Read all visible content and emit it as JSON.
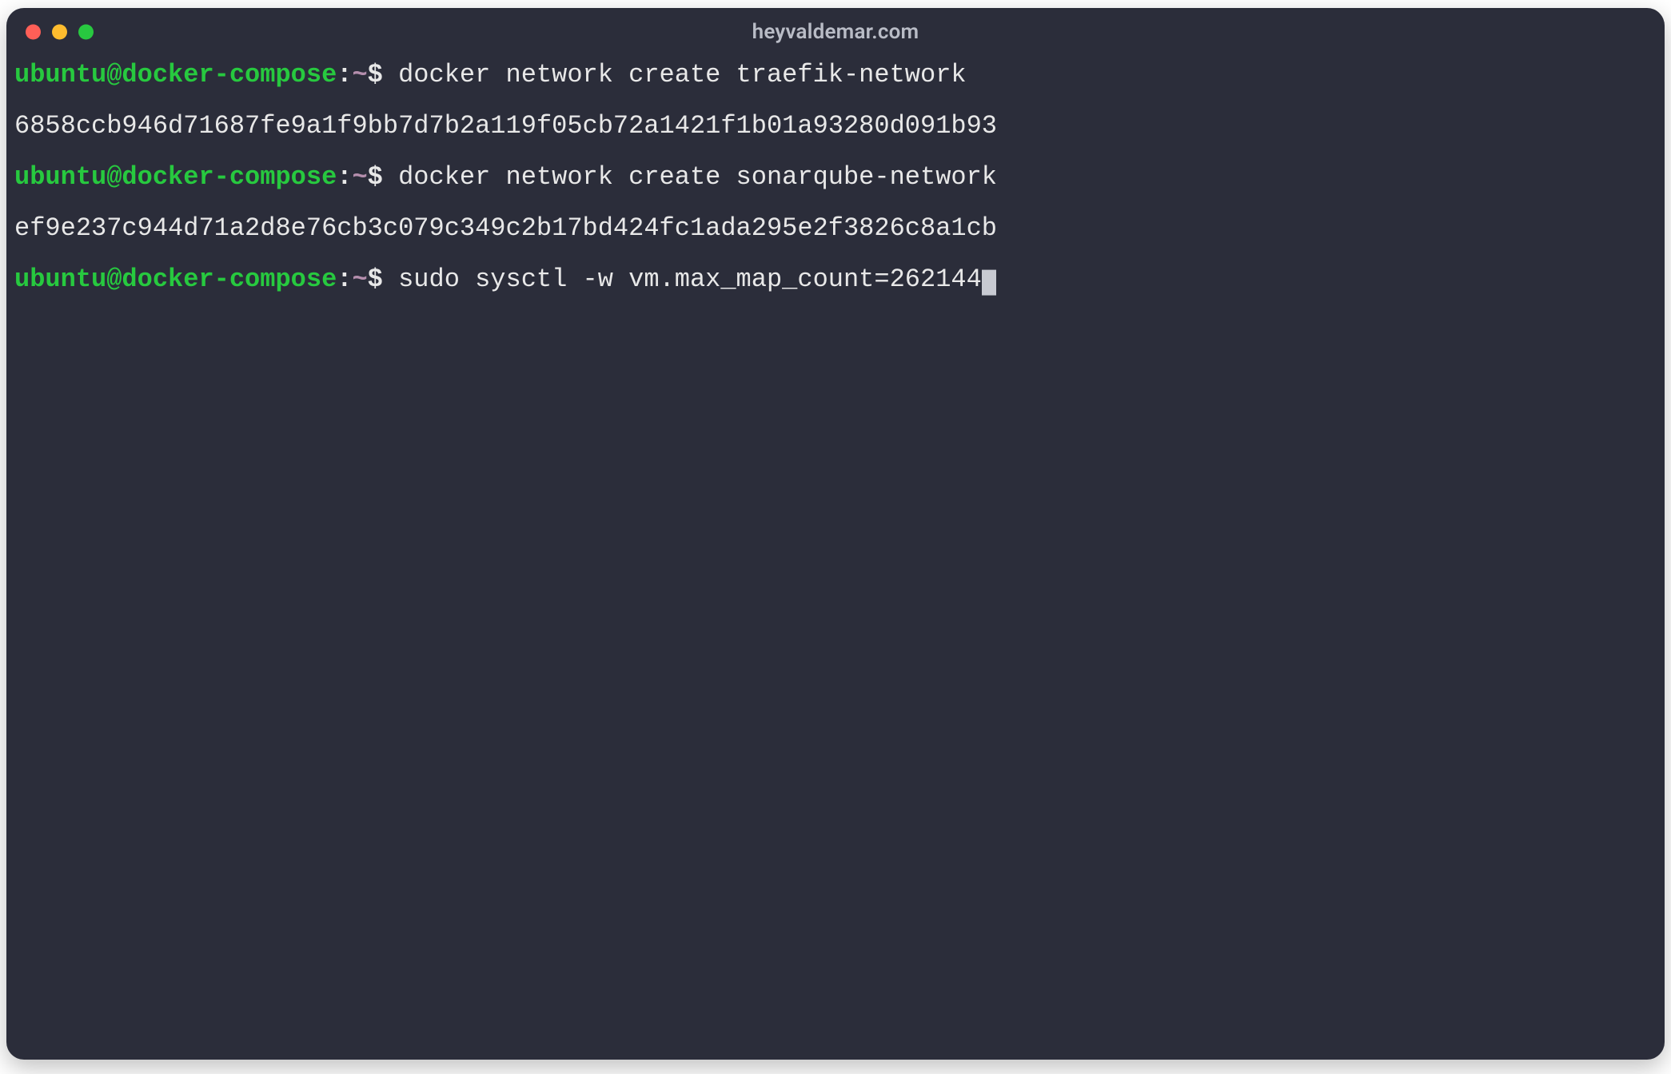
{
  "window": {
    "title": "heyvaldemar.com",
    "traffic_lights": [
      "close",
      "minimize",
      "zoom"
    ]
  },
  "prompt": {
    "user": "ubuntu",
    "host": "docker-compose",
    "path": "~",
    "symbol": "$"
  },
  "lines": [
    {
      "kind": "prompt",
      "command": "docker network create traefik-network"
    },
    {
      "kind": "output",
      "text": "6858ccb946d71687fe9a1f9bb7d7b2a119f05cb72a1421f1b01a93280d091b93"
    },
    {
      "kind": "prompt",
      "command": "docker network create sonarqube-network"
    },
    {
      "kind": "output",
      "text": "ef9e237c944d71a2d8e76cb3c079c349c2b17bd424fc1ada295e2f3826c8a1cb"
    },
    {
      "kind": "prompt",
      "command": "sudo sysctl -w vm.max_map_count=262144",
      "cursor": true
    }
  ]
}
